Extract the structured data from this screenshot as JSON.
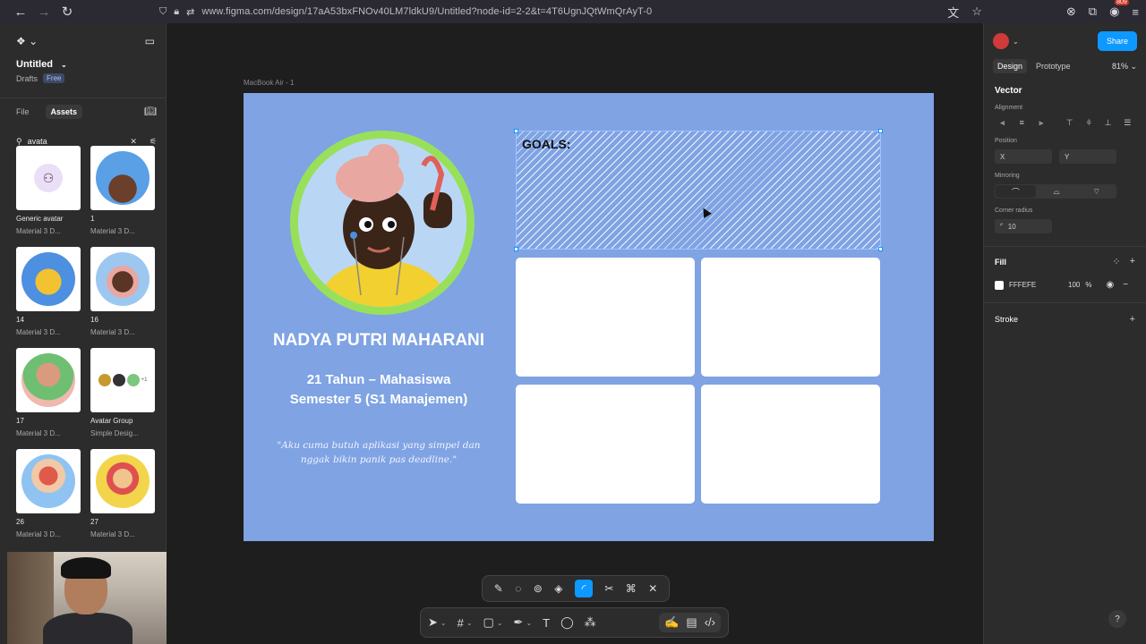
{
  "browser": {
    "url": "www.figma.com/design/17aA53bxFNOv40LM7ldkU9/Untitled?node-id=2-2&t=4T6UgnJQtWmQrAyT-0",
    "badge_count": "809"
  },
  "left_panel": {
    "project_title": "Untitled",
    "project_location": "Drafts",
    "plan_badge": "Free",
    "tabs": [
      {
        "label": "File"
      },
      {
        "label": "Assets"
      }
    ],
    "search_value": "avata",
    "assets": [
      {
        "name": "Generic avatar",
        "library": "Material 3 D..."
      },
      {
        "name": "1",
        "library": "Material 3 D..."
      },
      {
        "name": "14",
        "library": "Material 3 D..."
      },
      {
        "name": "16",
        "library": "Material 3 D..."
      },
      {
        "name": "17",
        "library": "Material 3 D..."
      },
      {
        "name": "Avatar Group",
        "library": "Simple Desig..."
      },
      {
        "name": "26",
        "library": "Material 3 D..."
      },
      {
        "name": "27",
        "library": "Material 3 D..."
      }
    ],
    "avatar_group_extra": "+1"
  },
  "canvas": {
    "frame_label": "MacBook Air - 1",
    "person_name": "NADYA PUTRI MAHARANI",
    "person_info_line1": "21 Tahun – Mahasiswa",
    "person_info_line2": "Semester 5 (S1 Manajemen)",
    "quote_line1": "\"Aku cuma butuh aplikasi yang simpel dan",
    "quote_line2": "nggak bikin panik pas deadline.\"",
    "goals_label": "GOALS:",
    "colors": {
      "frame_bg": "#7fa3e3",
      "ring": "#99e05a",
      "selection": "#0d99ff"
    }
  },
  "right_panel": {
    "share_label": "Share",
    "tabs": [
      {
        "label": "Design"
      },
      {
        "label": "Prototype"
      }
    ],
    "zoom": "81%",
    "section_title": "Vector",
    "alignment_label": "Alignment",
    "position_label": "Position",
    "x_label": "X",
    "y_label": "Y",
    "mirroring_label": "Mirroring",
    "corner_radius_label": "Corner radius",
    "corner_radius_value": "10",
    "fill_label": "Fill",
    "fill_hex": "FFFEFE",
    "fill_opacity": "100",
    "fill_percent": "%",
    "stroke_label": "Stroke",
    "help": "?"
  }
}
